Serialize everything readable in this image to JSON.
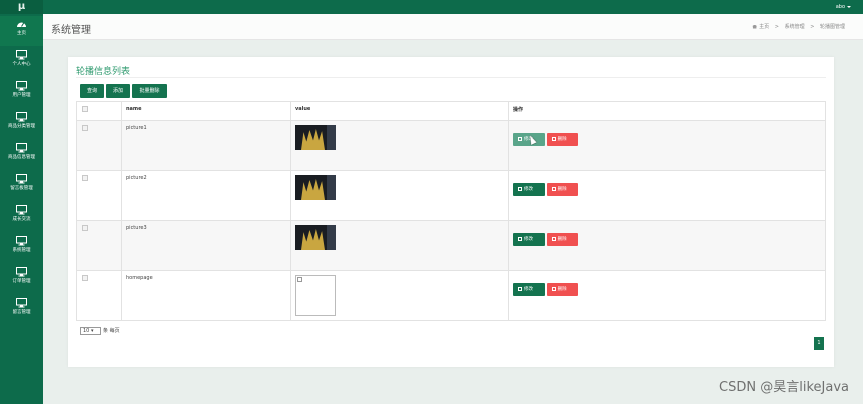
{
  "app": {
    "logo": "μ",
    "user": "abo"
  },
  "sidebar": {
    "items": [
      {
        "label": "主页",
        "icon": "dashboard-icon",
        "active": true
      },
      {
        "label": "个人中心",
        "icon": "monitor-icon"
      },
      {
        "label": "用户管理",
        "icon": "monitor-icon"
      },
      {
        "label": "商品分类管理",
        "icon": "monitor-icon"
      },
      {
        "label": "商品信息管理",
        "icon": "monitor-icon"
      },
      {
        "label": "留言板管理",
        "icon": "monitor-icon"
      },
      {
        "label": "成长交流",
        "icon": "monitor-icon"
      },
      {
        "label": "系统管理",
        "icon": "monitor-icon"
      },
      {
        "label": "订单管理",
        "icon": "monitor-icon"
      },
      {
        "label": "留言管理",
        "icon": "monitor-icon"
      }
    ]
  },
  "header": {
    "title": "系统管理",
    "breadcrumb": [
      "主页",
      "系统管理",
      "轮播图管理"
    ]
  },
  "panel": {
    "title": "轮播信息列表",
    "buttons": {
      "query": "查询",
      "add": "添加",
      "batch_delete": "批量删除"
    },
    "table": {
      "columns": [
        "",
        "name",
        "value",
        "操作"
      ],
      "rows": [
        {
          "name": "picture1",
          "image": "gold",
          "edit": "修改",
          "delete": "删除"
        },
        {
          "name": "picture2",
          "image": "gold",
          "edit": "修改",
          "delete": "删除"
        },
        {
          "name": "picture3",
          "image": "gold",
          "edit": "修改",
          "delete": "删除"
        },
        {
          "name": "homepage",
          "image": "broken",
          "edit": "修改",
          "delete": "删除"
        }
      ]
    },
    "pagination": {
      "page_size": "10",
      "per_page_label": "条 每页",
      "current_page": "1"
    }
  },
  "watermark": "CSDN @昊言likeJava",
  "colors": {
    "primary": "#0d6b4b",
    "danger": "#f05050",
    "title_green": "#2e9a6e"
  }
}
